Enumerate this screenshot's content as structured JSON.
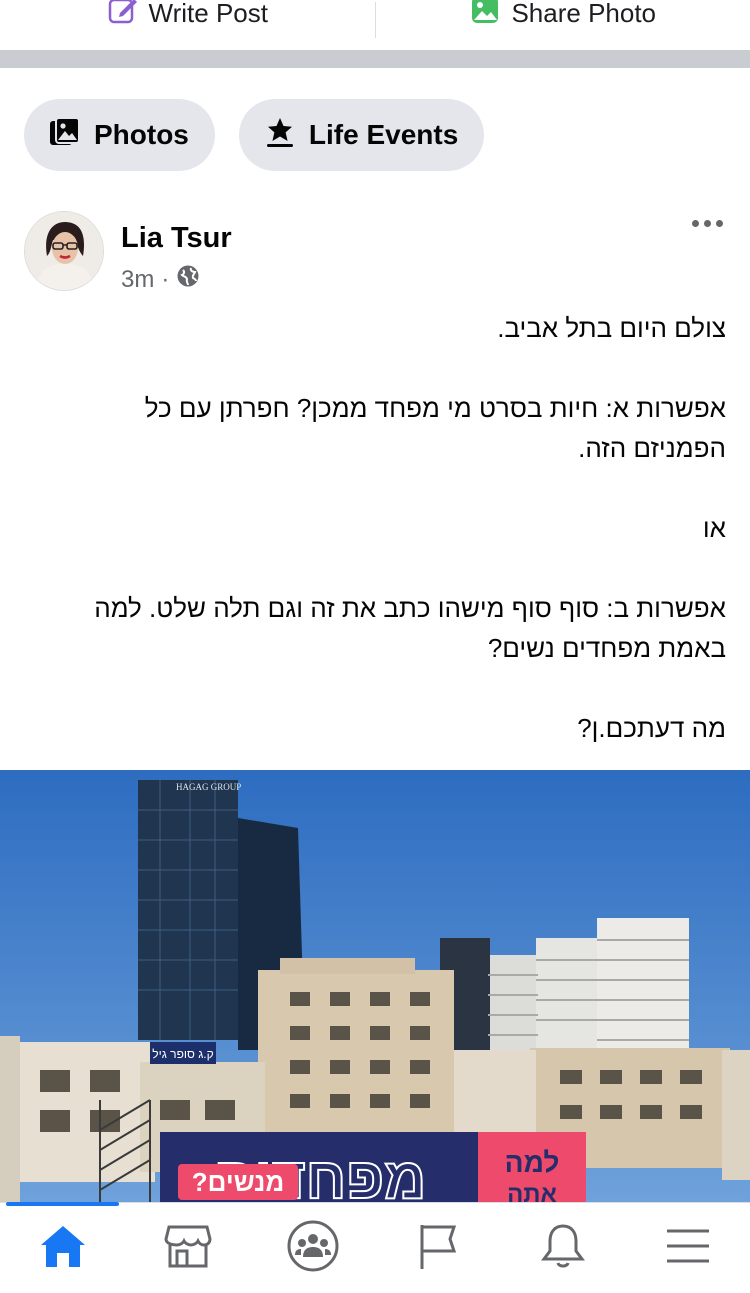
{
  "composer": {
    "write_post_label": "Write Post",
    "share_photo_label": "Share Photo"
  },
  "chips": {
    "photos_label": "Photos",
    "life_events_label": "Life Events"
  },
  "post": {
    "author": "Lia Tsur",
    "time": "3m",
    "separator": "·",
    "privacy_icon": "globe-icon",
    "text_lines": [
      "צולם היום בתל אביב.",
      "אפשרות א: חיות בסרט מי מפחד ממכן? חפרתן עם כל",
      "הפמניזם הזה.",
      "או",
      "אפשרות ב: סוף סוף מישהו כתב את זה וגם תלה שלט. למה",
      "באמת מפחדים נשים?",
      "מה דעתכם.ן?"
    ],
    "image": {
      "building_sign": "HAGAG GROUP",
      "store_sign": "ק.ג סופר גיל",
      "billboard_main": "מפחדים",
      "billboard_sub": "מנשים?",
      "billboard_right_1": "למה",
      "billboard_right_2": "אתה"
    }
  },
  "bottom_nav": {
    "tabs": [
      "home-icon",
      "marketplace-icon",
      "groups-icon",
      "pages-flag-icon",
      "notifications-bell-icon",
      "menu-icon"
    ],
    "active_tab": "home-icon"
  },
  "colors": {
    "accent": "#1877f2",
    "chip_bg": "#e4e6eb",
    "secondary_text": "#65676b",
    "write_post_icon": "#8c5fd1",
    "share_photo_icon": "#45bd62"
  }
}
